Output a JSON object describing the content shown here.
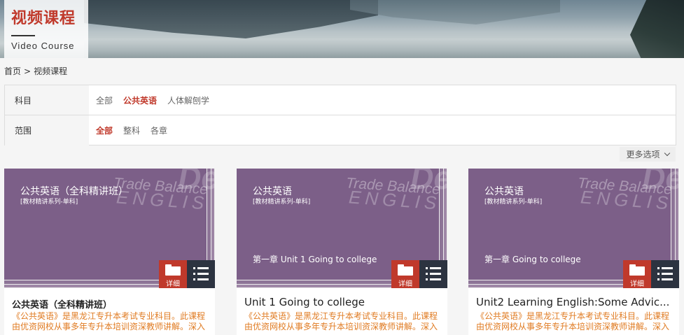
{
  "banner": {
    "title_cn": "视频课程",
    "title_en": "Video Course"
  },
  "breadcrumb": {
    "home": "首页",
    "separator": ">",
    "current": "视频课程"
  },
  "filter": {
    "subject": {
      "label": "科目",
      "options": [
        "全部",
        "公共英语",
        "人体解刨学"
      ],
      "active_index": 1
    },
    "scope": {
      "label": "范围",
      "options": [
        "全部",
        "整科",
        "各章"
      ],
      "active_index": 0
    },
    "more_label": "更多选项"
  },
  "colors": {
    "accent": "#c0392b",
    "cover_purple": "#7c5f88",
    "desc_orange": "#e07b22",
    "list_button": "#2c3340"
  },
  "cards": [
    {
      "cover_title": "公共英语（全科精讲班）",
      "cover_subtitle": "[教材精讲系列-单科]",
      "cover_chapter": "",
      "watermark_1": "Trade Balance",
      "watermark_2": "ENGLIS",
      "watermark_3": "De",
      "detail_label": "详细",
      "title": "公共英语（全科精讲班）",
      "description": "《公共英语》是黑龙江专升本考试专业科目。此课程由优资网校从事多年专升本培训资深教师讲解。深入"
    },
    {
      "cover_title": "公共英语",
      "cover_subtitle": "[教材精讲系列-单科]",
      "cover_chapter": "第一章 Unit 1 Going to college",
      "watermark_1": "Trade Balance",
      "watermark_2": "ENGLIS",
      "watermark_3": "De",
      "detail_label": "详细",
      "title": "Unit 1 Going to college",
      "description": "《公共英语》是黑龙江专升本考试专业科目。此课程由优资网校从事多年专升本培训资深教师讲解。深入"
    },
    {
      "cover_title": "公共英语",
      "cover_subtitle": "[教材精讲系列-单科]",
      "cover_chapter": "第一章 Going to college",
      "watermark_1": "Trade Balance",
      "watermark_2": "ENGLIS",
      "watermark_3": "De",
      "detail_label": "详细",
      "title": "Unit2 Learning English:Some Advic...",
      "description": "《公共英语》是黑龙江专升本考试专业科目。此课程由优资网校从事多年专升本培训资深教师讲解。深入"
    }
  ]
}
